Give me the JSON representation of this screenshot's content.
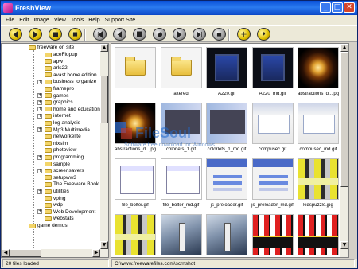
{
  "window": {
    "title": "FreshView",
    "controls": [
      "_",
      "□",
      "✕"
    ]
  },
  "menu": [
    "File",
    "Edit",
    "Image",
    "View",
    "Tools",
    "Help",
    "Support Site"
  ],
  "toolbar": {
    "groups": [
      [
        {
          "icon": "back-icon",
          "style": "yellow"
        },
        {
          "icon": "forward-icon",
          "style": "yellow"
        },
        {
          "icon": "slideshow-icon",
          "style": "yellow"
        },
        {
          "icon": "zoom-icon",
          "style": "yellow"
        }
      ],
      [
        {
          "icon": "first-icon",
          "style": "gray"
        },
        {
          "icon": "previous-icon",
          "style": "gray"
        },
        {
          "icon": "fullscreen-icon",
          "style": "gray"
        },
        {
          "icon": "refresh-icon",
          "style": "gray"
        },
        {
          "icon": "next-icon",
          "style": "gray"
        },
        {
          "icon": "last-icon",
          "style": "gray"
        },
        {
          "icon": "print-icon",
          "style": "gray"
        }
      ],
      [
        {
          "icon": "options-icon",
          "style": "yellow"
        },
        {
          "icon": "help-icon",
          "style": "yellow"
        }
      ]
    ]
  },
  "tree": {
    "root": "freeware on site",
    "items": [
      {
        "label": "aceFlopup",
        "expandable": false
      },
      {
        "label": "apw",
        "expandable": false
      },
      {
        "label": "arls22",
        "expandable": false
      },
      {
        "label": "avast home edition",
        "expandable": false
      },
      {
        "label": "business_organize",
        "expandable": true
      },
      {
        "label": "framepro",
        "expandable": false
      },
      {
        "label": "games",
        "expandable": true
      },
      {
        "label": "graphics",
        "expandable": true
      },
      {
        "label": "home and education",
        "expandable": true
      },
      {
        "label": "internet",
        "expandable": true
      },
      {
        "label": "log analysis",
        "expandable": false
      },
      {
        "label": "Mp3 Multimedia",
        "expandable": true
      },
      {
        "label": "networkelite",
        "expandable": false
      },
      {
        "label": "nixsim",
        "expandable": false
      },
      {
        "label": "photoview",
        "expandable": false
      },
      {
        "label": "programming",
        "expandable": true
      },
      {
        "label": "sample",
        "expandable": false
      },
      {
        "label": "screensavers",
        "expandable": true
      },
      {
        "label": "setupww3",
        "expandable": false
      },
      {
        "label": "The Freeware Book",
        "expandable": false
      },
      {
        "label": "utilities",
        "expandable": true
      },
      {
        "label": "vping",
        "expandable": false
      },
      {
        "label": "wdp",
        "expandable": false
      },
      {
        "label": "Web Development",
        "expandable": true
      },
      {
        "label": "webstats",
        "expandable": false
      }
    ],
    "last_partial": "game demos"
  },
  "files": [
    {
      "name": "",
      "kind": "folder"
    },
    {
      "name": "altered",
      "kind": "folder"
    },
    {
      "name": "A220.gif",
      "kind": "phone"
    },
    {
      "name": "A220_md.gif",
      "kind": "phone"
    },
    {
      "name": "abstractions_d...jpg",
      "kind": "fractal"
    },
    {
      "name": "abstractions_d...jpg",
      "kind": "fractal"
    },
    {
      "name": "colorlets_1.gif",
      "kind": "colorlets"
    },
    {
      "name": "colorlets_1_md.gif",
      "kind": "colorlets"
    },
    {
      "name": "compusec.gif",
      "kind": "dialog"
    },
    {
      "name": "compusec_md.gif",
      "kind": "dialog"
    },
    {
      "name": "file_bolter.gif",
      "kind": "filebolter"
    },
    {
      "name": "file_bolter_md.gif",
      "kind": "filebolter"
    },
    {
      "name": "js_preloader.gif",
      "kind": "preloader"
    },
    {
      "name": "js_preloader_md.gif",
      "kind": "preloader"
    },
    {
      "name": "kidspuzzle.jpg",
      "kind": "puzzle"
    },
    {
      "name": "kidspuzzle_md.gif",
      "kind": "puzzle"
    },
    {
      "name": "lthouse_saver.jpg",
      "kind": "lighthouse"
    },
    {
      "name": "lthouse_saver_md.jpg",
      "kind": "lighthouse"
    },
    {
      "name": "mzoom.gif",
      "kind": "mzoom"
    },
    {
      "name": "mzoom_md.gif",
      "kind": "mzoom"
    }
  ],
  "watermark": {
    "text": "FileSoul",
    "subtext": "Software free download for Windows"
  },
  "status": {
    "count": "20 files loaded",
    "path": "C:\\www.freewarefiles.com\\scrnshot"
  }
}
